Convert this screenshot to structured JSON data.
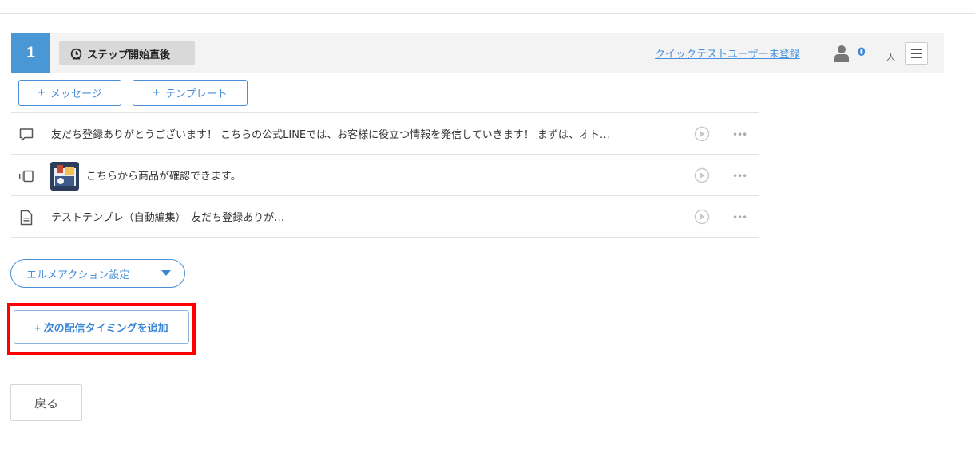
{
  "step": {
    "number": "1",
    "timing_label": "ステップ開始直後",
    "quick_test_link": "クイックテストユーザー未登録",
    "user_count": "0",
    "person_glyph": "人"
  },
  "add_buttons": {
    "message_label": "メッセージ",
    "template_label": "テンプレート",
    "plus": "+"
  },
  "messages": [
    {
      "type_icon": "speech-bubble-icon",
      "text": "友だち登録ありがとうございます！ こちらの公式LINEでは、お客様に役立つ情報を発信していきます！ まずは、オト…"
    },
    {
      "type_icon": "carousel-icon",
      "text": "こちらから商品が確認できます。"
    },
    {
      "type_icon": "document-icon",
      "text": "テストテンプレ（自動編集）　友だち登録ありが…"
    }
  ],
  "more_glyph": "•••",
  "action_select": {
    "label": "エルメアクション設定"
  },
  "next_timing_button": {
    "label": "+ 次の配信タイミングを追加"
  },
  "back_button": {
    "label": "戻る"
  },
  "colors": {
    "accent": "#4a97d6",
    "link": "#4a90d9",
    "highlight": "#ff0000"
  }
}
